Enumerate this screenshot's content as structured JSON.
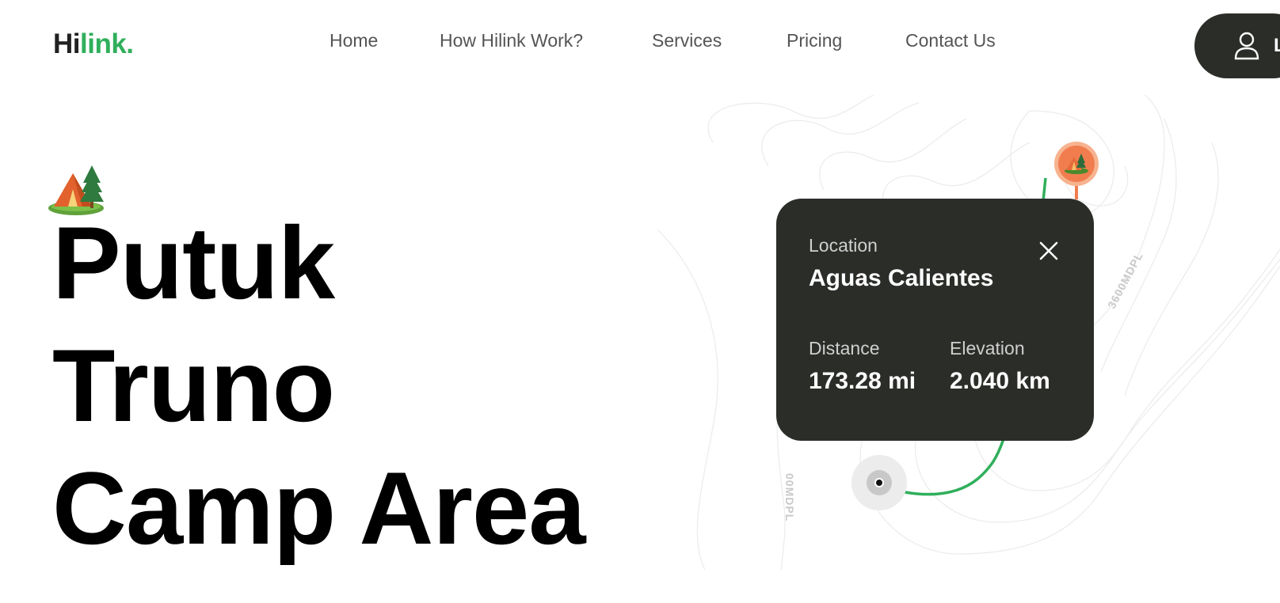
{
  "brand": {
    "logo_dark": "Hi",
    "logo_accent": "link.",
    "accent_color": "#30af5b",
    "dark_color": "#2b2d29"
  },
  "nav": {
    "items": [
      {
        "label": "Home"
      },
      {
        "label": "How Hilink Work?"
      },
      {
        "label": "Services"
      },
      {
        "label": "Pricing"
      },
      {
        "label": "Contact Us"
      }
    ],
    "login_label": "L",
    "login_icon": "user-icon"
  },
  "hero": {
    "icon": "camp-icon",
    "title_lines": [
      "Putuk",
      "Truno",
      "Camp Area"
    ]
  },
  "map": {
    "contour_labels": [
      "3600MDPL",
      "00MDPL"
    ],
    "destination_marker_icon": "camp-icon",
    "destination_color": "#f17d4f",
    "route_color": "#30af5b"
  },
  "location_card": {
    "location_label": "Location",
    "location_value": "Aguas Calientes",
    "distance_label": "Distance",
    "distance_value": "173.28 mi",
    "elevation_label": "Elevation",
    "elevation_value": "2.040 km",
    "close_icon": "close-icon"
  }
}
